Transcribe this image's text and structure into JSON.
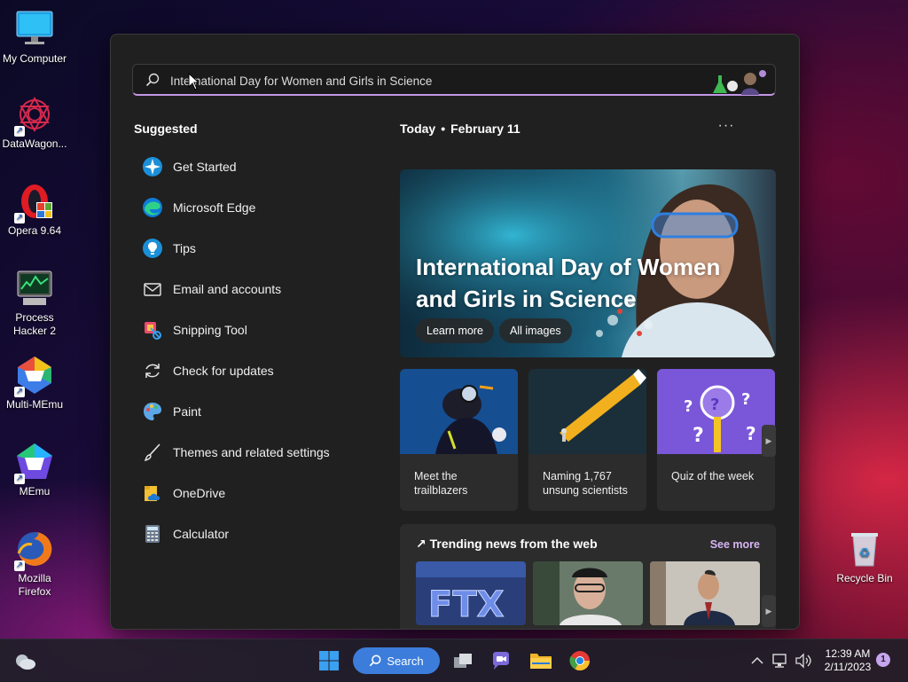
{
  "desktop": {
    "icons": [
      {
        "label_lines": [
          "My Computer"
        ],
        "icon": "monitor-icon"
      },
      {
        "label_lines": [
          "DataWagon..."
        ],
        "icon": "datawagon-icon"
      },
      {
        "label_lines": [
          "Opera 9.64"
        ],
        "icon": "opera-icon"
      },
      {
        "label_lines": [
          "Process",
          "Hacker 2"
        ],
        "icon": "process-hacker-icon"
      },
      {
        "label_lines": [
          "Multi-MEmu"
        ],
        "icon": "multi-memu-icon"
      },
      {
        "label_lines": [
          "MEmu"
        ],
        "icon": "memu-icon"
      },
      {
        "label_lines": [
          "Mozilla",
          "Firefox"
        ],
        "icon": "firefox-icon"
      },
      {
        "label_lines": [
          "Recycle Bin"
        ],
        "icon": "recycle-bin-icon"
      }
    ]
  },
  "search": {
    "value": "International Day for Women and Girls in Science",
    "icon": "search-icon"
  },
  "suggested": {
    "title": "Suggested",
    "items": [
      {
        "label": "Get Started",
        "icon": "get-started-icon"
      },
      {
        "label": "Microsoft Edge",
        "icon": "edge-icon"
      },
      {
        "label": "Tips",
        "icon": "tips-icon"
      },
      {
        "label": "Email and accounts",
        "icon": "mail-icon"
      },
      {
        "label": "Snipping Tool",
        "icon": "snipping-tool-icon"
      },
      {
        "label": "Check for updates",
        "icon": "refresh-icon"
      },
      {
        "label": "Paint",
        "icon": "paint-icon"
      },
      {
        "label": "Themes and related settings",
        "icon": "brush-icon"
      },
      {
        "label": "OneDrive",
        "icon": "onedrive-icon"
      },
      {
        "label": "Calculator",
        "icon": "calculator-icon"
      }
    ]
  },
  "today": {
    "label": "Today",
    "separator": "•",
    "date": "February 11",
    "more": "···"
  },
  "hero": {
    "title": "International Day of Women and Girls in Science",
    "buttons": [
      "Learn more",
      "All images"
    ]
  },
  "cards": [
    {
      "caption": "Meet the trailblazers"
    },
    {
      "caption": "Naming 1,767 unsung scientists"
    },
    {
      "caption": "Quiz of the week"
    }
  ],
  "trending": {
    "title": "Trending news from the web",
    "see_more": "See more"
  },
  "taskbar": {
    "search_label": "Search",
    "time": "12:39 AM",
    "date": "2/11/2023",
    "notification_count": "1"
  },
  "colors": {
    "accent": "#c497e6",
    "search_pill": "#3c7ddb",
    "panel_bg": "#202020"
  }
}
